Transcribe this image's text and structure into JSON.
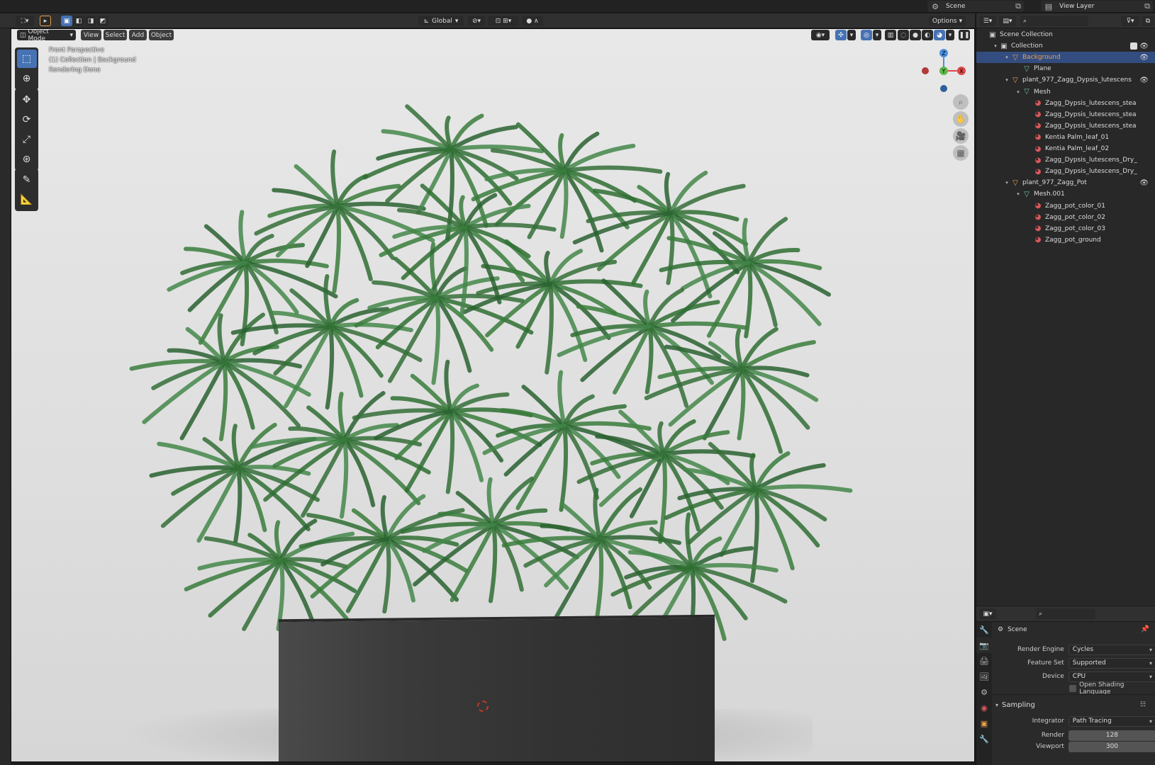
{
  "topbar": {
    "scene_label": "Scene",
    "view_layer_label": "View Layer"
  },
  "viewport_header": {
    "transform_orientation": "Global",
    "options_label": "Options"
  },
  "viewport_menu": {
    "mode": "Object Mode",
    "view": "View",
    "select": "Select",
    "add": "Add",
    "object": "Object"
  },
  "viewport_overlay": {
    "line1": "Front Perspective",
    "line2": "(1) Collection | Background",
    "line3": "Rendering Done"
  },
  "gizmo": {
    "z": "Z",
    "y": "Y",
    "x": "X"
  },
  "outliner": {
    "rows": [
      {
        "label": "Scene Collection",
        "type": "scene-collection"
      },
      {
        "label": "Collection",
        "type": "collection"
      },
      {
        "label": "Background",
        "type": "object"
      },
      {
        "label": "Plane",
        "type": "mesh"
      },
      {
        "label": "plant_977_Zagg_Dypsis_lutescens",
        "type": "object"
      },
      {
        "label": "Mesh",
        "type": "mesh"
      },
      {
        "label": "Zagg_Dypsis_lutescens_stea",
        "type": "material"
      },
      {
        "label": "Zagg_Dypsis_lutescens_stea",
        "type": "material"
      },
      {
        "label": "Zagg_Dypsis_lutescens_stea",
        "type": "material"
      },
      {
        "label": "Kentia Palm_leaf_01",
        "type": "material"
      },
      {
        "label": "Kentia Palm_leaf_02",
        "type": "material"
      },
      {
        "label": "Zagg_Dypsis_lutescens_Dry_",
        "type": "material"
      },
      {
        "label": "Zagg_Dypsis_lutescens_Dry_",
        "type": "material"
      },
      {
        "label": "plant_977_Zagg_Pot",
        "type": "object"
      },
      {
        "label": "Mesh.001",
        "type": "mesh"
      },
      {
        "label": "Zagg_pot_color_01",
        "type": "material"
      },
      {
        "label": "Zagg_pot_color_02",
        "type": "material"
      },
      {
        "label": "Zagg_pot_color_03",
        "type": "material"
      },
      {
        "label": "Zagg_pot_ground",
        "type": "material"
      }
    ]
  },
  "properties": {
    "context_label": "Scene",
    "render_engine": {
      "label": "Render Engine",
      "value": "Cycles"
    },
    "feature_set": {
      "label": "Feature Set",
      "value": "Supported"
    },
    "device": {
      "label": "Device",
      "value": "CPU"
    },
    "osl_label": "Open Shading Language",
    "sampling_label": "Sampling",
    "integrator": {
      "label": "Integrator",
      "value": "Path Tracing"
    },
    "render_samples": {
      "label": "Render",
      "value": "128"
    },
    "viewport_samples": {
      "label": "Viewport",
      "value": "300"
    }
  },
  "colors": {
    "accent": "#4772b3",
    "selection": "#334d80",
    "object_orange": "#e8a04a",
    "mesh_green": "#6fc49a",
    "material_red": "#d9585c"
  }
}
